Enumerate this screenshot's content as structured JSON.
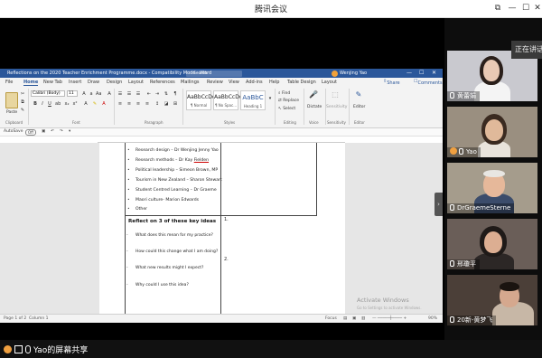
{
  "app": {
    "title": "腾讯会议"
  },
  "word": {
    "doc_title": "Reflections on the 2020 Teacher Enrichment Programme.docx - Compatibility Mode - Word",
    "search_placeholder": "Search",
    "user": "Wenjing Yao",
    "menu": [
      "File",
      "Home",
      "New Tab",
      "Insert",
      "Draw",
      "Design",
      "Layout",
      "References",
      "Mailings",
      "Review",
      "View",
      "Add-ins",
      "Help",
      "Table Design",
      "Layout"
    ],
    "share_label": "Share",
    "comments_label": "Comments",
    "ribbon": {
      "paste": "Paste",
      "font_name": "Calibri (Body)",
      "font_size": "11",
      "groups": [
        "Clipboard",
        "Font",
        "Paragraph",
        "Styles",
        "Editing",
        "Voice",
        "Sensitivity",
        "Editor"
      ],
      "styles": [
        {
          "sample": "AaBbCcDd",
          "name": "¶ Normal"
        },
        {
          "sample": "AaBbCcDd",
          "name": "¶ No Spac..."
        },
        {
          "sample": "AaBbC",
          "name": "Heading 1"
        }
      ],
      "find": "Find",
      "replace": "Replace",
      "select": "Select",
      "dictate": "Dictate",
      "sensitivity": "Sensitivity",
      "editor": "Editor"
    },
    "qat": {
      "autosave": "AutoSave",
      "toggle": "Off"
    },
    "bullets": [
      "Research design – Dr Wenjing Jenny Yao",
      "Research methods – Dr Kay Fielden",
      "Political leadership – Simeon Brown, MP",
      "Tourism in New Zealand – Sharon Stewart",
      "Student Centred Learning – Dr Graeme",
      "Maori culture- Marion Edwards",
      "Other"
    ],
    "reflect_heading": "Reflect on 3 of these key ideas",
    "questions": [
      "What does this mean for my practice?",
      "How could this change what I am doing?",
      "What new results might I expect?",
      "Why could I use this idea?"
    ],
    "numbers": [
      "1.",
      "2."
    ],
    "status": {
      "page": "Page 1 of 2",
      "col": "Column 1",
      "focus": "Focus",
      "zoom": "90%"
    },
    "watermark": "Activate Windows",
    "watermark_sub": "Go to Settings to activate Windows."
  },
  "participants": [
    {
      "name": "黄蕾娟",
      "bg": "#c9c9cf",
      "shirt": "#f4f4f4",
      "hair": "#2a1f1a",
      "skin": "#e9c9b4"
    },
    {
      "name": "Yao",
      "bg": "#9a8f80",
      "shirt": "#e9e4dc",
      "hair": "#3a2a20",
      "skin": "#e0b99a",
      "speaking": true
    },
    {
      "name": "DrGraemeSterne",
      "bg": "#a59c8c",
      "shirt": "#3b4c6b",
      "hair": "#e8e6e2",
      "skin": "#e6b89a"
    },
    {
      "name": "邢瓊平",
      "bg": "#6a5e58",
      "shirt": "#2c2726",
      "hair": "#1f1a18",
      "skin": "#dcae92"
    },
    {
      "name": "20新-黄梦飞",
      "bg": "#4b3f38",
      "shirt": "#c7b7a6",
      "hair": "#1a1410",
      "skin": "#d5a88e"
    }
  ],
  "overlay_tag": "正在讲话",
  "bottom": {
    "share_text": "Yao的屏幕共享"
  }
}
